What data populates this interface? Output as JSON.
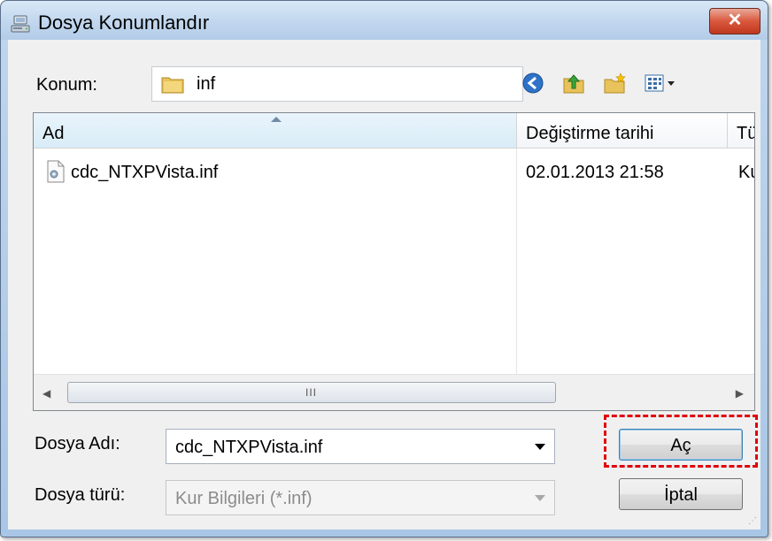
{
  "window": {
    "title": "Dosya Konumlandır",
    "close_label": "✕"
  },
  "location": {
    "label": "Konum:",
    "current_folder": "inf"
  },
  "list": {
    "columns": [
      "Ad",
      "Değiştirme tarihi",
      "Tü"
    ],
    "rows": [
      {
        "name": "cdc_NTXPVista.inf",
        "modified": "02.01.2013 21:58",
        "type": "Ku"
      }
    ],
    "scroll_grip": "III"
  },
  "filename": {
    "label": "Dosya Adı:",
    "value": "cdc_NTXPVista.inf"
  },
  "filetype": {
    "label": "Dosya türü:",
    "value": "Kur Bilgileri (*.inf)"
  },
  "buttons": {
    "open": "Aç",
    "cancel": "İptal"
  },
  "icons": {
    "title": "computer-drive-icon",
    "back": "back-arrow-icon",
    "up": "up-folder-icon",
    "new_folder": "new-folder-icon",
    "view_menu": "view-menu-icon",
    "file": "inf-file-icon"
  },
  "colors": {
    "highlight": "#e0000c",
    "close_button": "#c0381f"
  }
}
